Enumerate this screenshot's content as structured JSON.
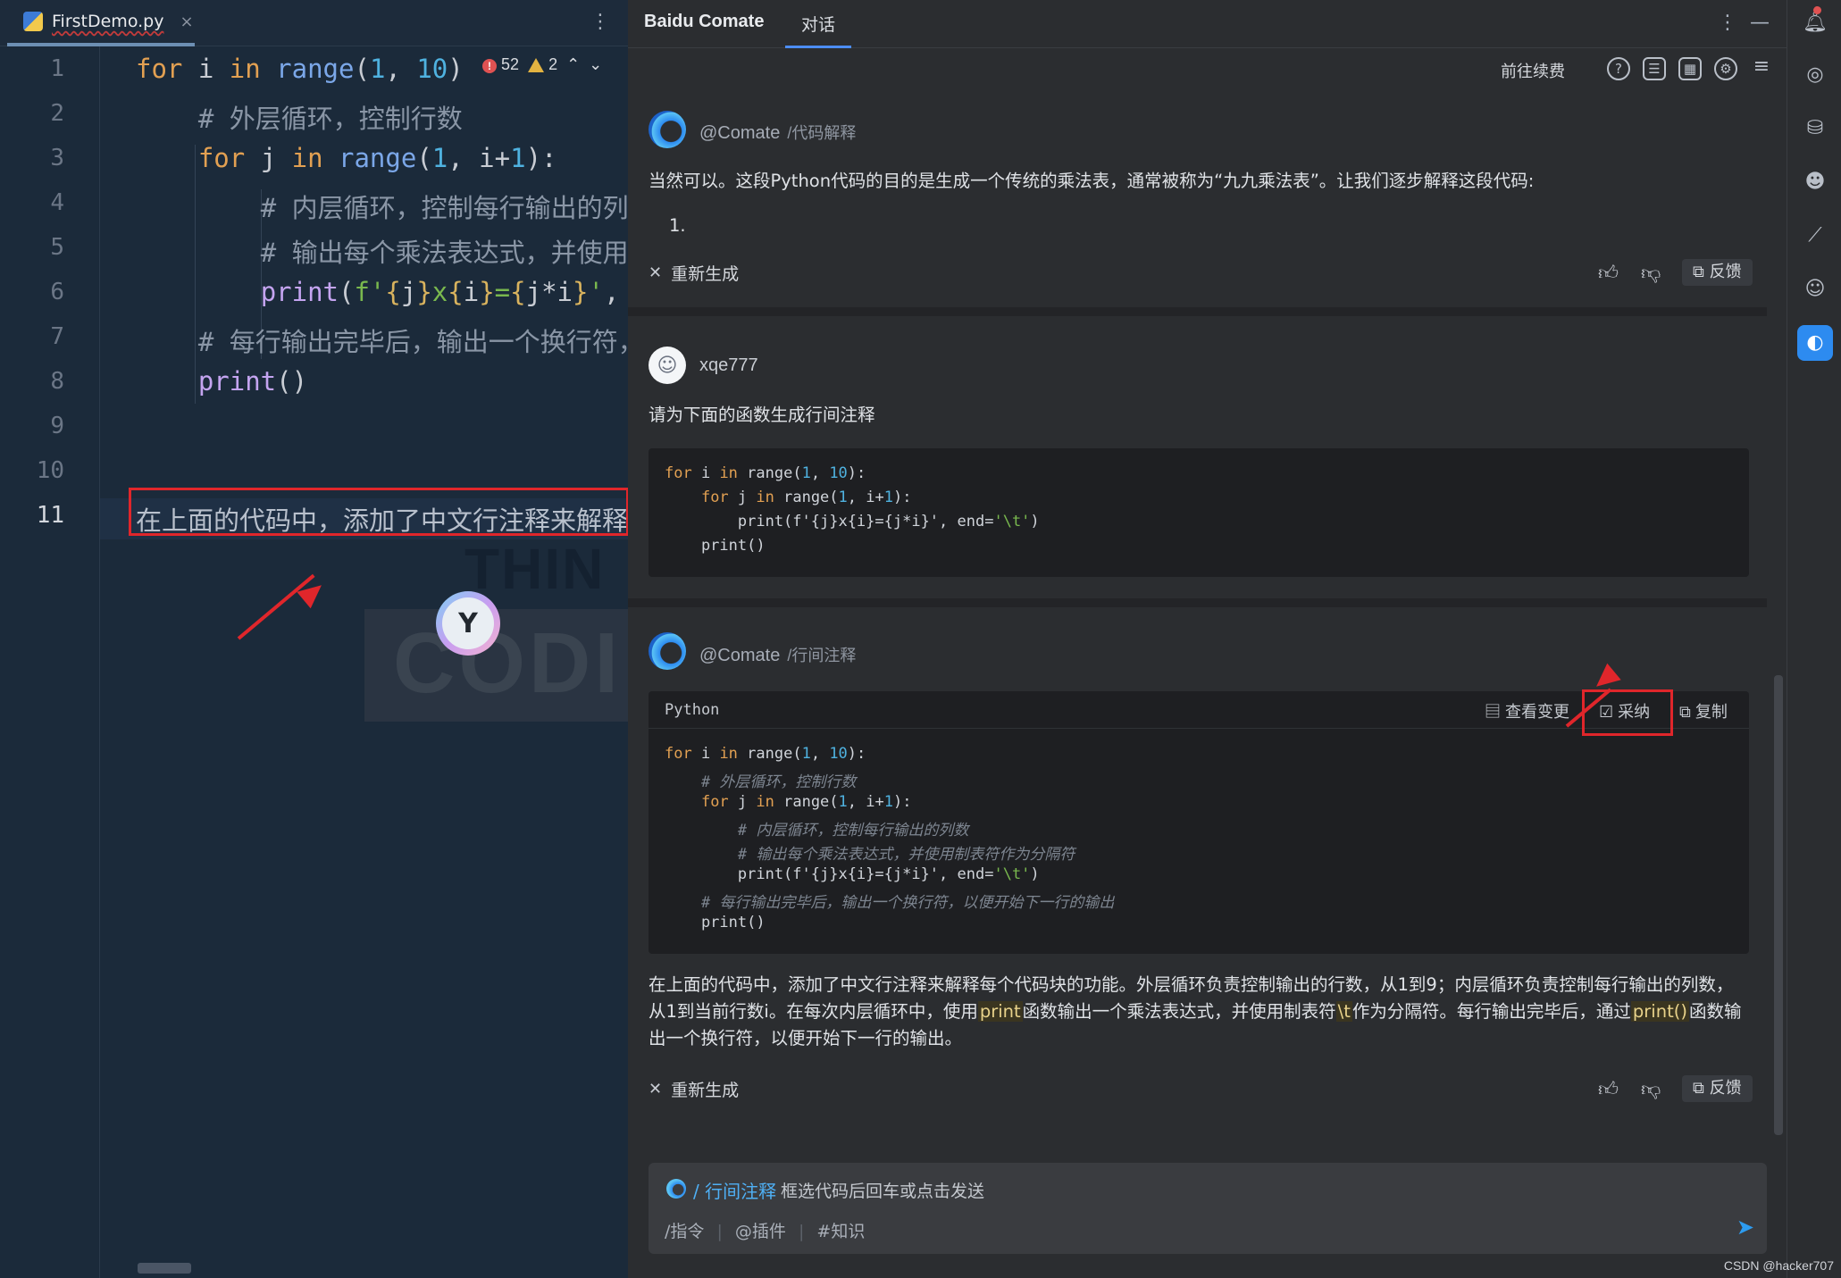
{
  "editor": {
    "file_tab": "FirstDemo.py",
    "close_glyph": "×",
    "kebab_glyph": "⋮",
    "inspections": {
      "errors": "52",
      "warnings": "2"
    },
    "line_numbers": [
      "1",
      "2",
      "3",
      "4",
      "5",
      "6",
      "7",
      "8",
      "9",
      "10",
      "11"
    ],
    "watermark": {
      "top": "THIN",
      "bottom": "CODI"
    }
  },
  "panel": {
    "title": "Baidu Comate",
    "tab": "对话",
    "toolbar_renew": "前往续费",
    "messages": [
      {
        "sender": "@Comate",
        "command": "/代码解释",
        "text": "当然可以。这段Python代码的目的是生成一个传统的乘法表，通常被称为“九九乘法表”。让我们逐步解释这段代码:",
        "list_item": "1.",
        "regenerate": "重新生成",
        "feedback": "反馈"
      },
      {
        "sender": "xqe777",
        "text": "请为下面的函数生成行间注释"
      },
      {
        "sender": "@Comate",
        "command": "/行间注释",
        "code_lang": "Python",
        "view_changes": "查看变更",
        "accept": "采纳",
        "copy": "复制",
        "explain_parts": [
          "在上面的代码中，添加了中文行注释来解释每个代码块的功能。外层循环负责控制输出的行数，从1到9；内层循环负责控制每行输出的列数，从1到当前行数i。在每次内层循环中，使用",
          "print",
          "函数输出一个乘法表达式，并使用制表符",
          "\\t",
          "作为分隔符。每行输出完毕后，通过",
          "print()",
          "函数输出一个换行符，以便开始下一行的输出。"
        ],
        "regenerate": "重新生成",
        "feedback": "反馈"
      }
    ],
    "input": {
      "command": "/ 行间注释",
      "hint": "框选代码后回车或点击发送",
      "tools": [
        "/指令",
        "@插件",
        "#知识"
      ],
      "separator": "|"
    }
  },
  "credit": "CSDN @hacker707",
  "colors": {
    "accent": "#2d8bf0",
    "annotation_red": "#e0262b"
  }
}
